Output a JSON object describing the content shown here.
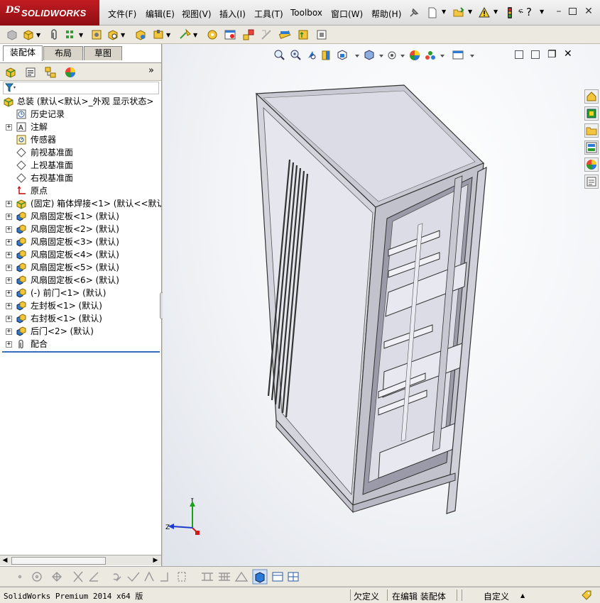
{
  "app": {
    "brand": "SOLIDWORKS",
    "logo_mark": "DS"
  },
  "menu": [
    {
      "label": "文件(F)"
    },
    {
      "label": "编辑(E)"
    },
    {
      "label": "视图(V)"
    },
    {
      "label": "插入(I)"
    },
    {
      "label": "工具(T)"
    },
    {
      "label": "Toolbox"
    },
    {
      "label": "窗口(W)"
    },
    {
      "label": "帮助(H)"
    }
  ],
  "pane": {
    "tabs": [
      {
        "label": "装配体"
      },
      {
        "label": "布局"
      },
      {
        "label": "草图"
      }
    ],
    "more": "»",
    "tree": [
      {
        "label": "总装  (默认<默认>_外观 显示状态>",
        "icon": "assembly-icon",
        "expander": ""
      },
      {
        "label": "历史记录",
        "icon": "history-icon",
        "expander": ""
      },
      {
        "label": "注解",
        "icon": "annotations-icon",
        "expander": "+"
      },
      {
        "label": "传感器",
        "icon": "sensor-icon",
        "expander": ""
      },
      {
        "label": "前视基准面",
        "icon": "plane-icon",
        "expander": ""
      },
      {
        "label": "上视基准面",
        "icon": "plane-icon",
        "expander": ""
      },
      {
        "label": "右视基准面",
        "icon": "plane-icon",
        "expander": ""
      },
      {
        "label": "原点",
        "icon": "origin-icon",
        "expander": ""
      },
      {
        "label": "(固定) 箱体焊接<1> (默认<<默认",
        "icon": "part-icon",
        "expander": "+"
      },
      {
        "label": "风扇固定板<1> (默认)",
        "icon": "subassembly-icon",
        "expander": "+"
      },
      {
        "label": "风扇固定板<2> (默认)",
        "icon": "subassembly-icon",
        "expander": "+"
      },
      {
        "label": "风扇固定板<3> (默认)",
        "icon": "subassembly-icon",
        "expander": "+"
      },
      {
        "label": "风扇固定板<4> (默认)",
        "icon": "subassembly-icon",
        "expander": "+"
      },
      {
        "label": "风扇固定板<5> (默认)",
        "icon": "subassembly-icon",
        "expander": "+"
      },
      {
        "label": "风扇固定板<6> (默认)",
        "icon": "subassembly-icon",
        "expander": "+"
      },
      {
        "label": "(-) 前门<1> (默认)",
        "icon": "subassembly-icon",
        "expander": "+"
      },
      {
        "label": "左封板<1> (默认)",
        "icon": "subassembly-icon",
        "expander": "+"
      },
      {
        "label": "右封板<1> (默认)",
        "icon": "subassembly-icon",
        "expander": "+"
      },
      {
        "label": "后门<2> (默认)",
        "icon": "subassembly-icon",
        "expander": "+"
      },
      {
        "label": "配合",
        "icon": "mates-icon",
        "expander": "+"
      }
    ]
  },
  "triad": {
    "y": "Y",
    "z": "Z"
  },
  "status": {
    "product": "SolidWorks Premium 2014 x64 版",
    "constraint": "欠定义",
    "mode": "在编辑 装配体",
    "units": "自定义",
    "units_arrow": "▲"
  },
  "colors": {
    "brand_red": "#b5171d",
    "selection_blue": "#3a6cc0",
    "sheet_metal": "#dcdce8"
  }
}
